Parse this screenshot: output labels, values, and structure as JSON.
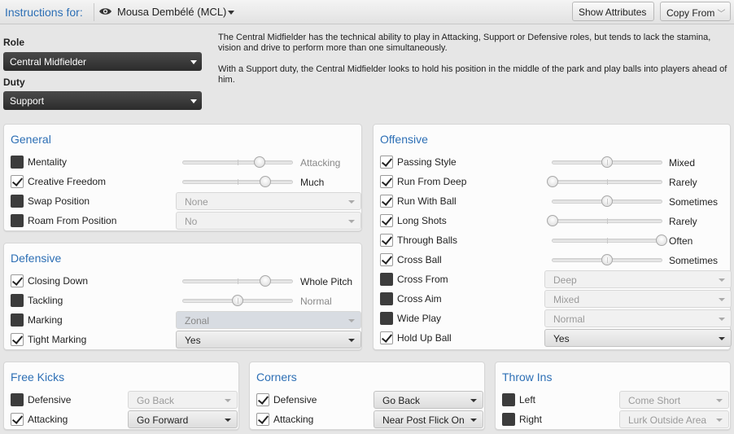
{
  "topbar": {
    "instructions_label": "Instructions for:",
    "player": "Mousa Dembélé (MCL)",
    "show_attributes": "Show Attributes",
    "copy_from": "Copy From"
  },
  "role": {
    "role_label": "Role",
    "role_value": "Central Midfielder",
    "duty_label": "Duty",
    "duty_value": "Support"
  },
  "description": {
    "p1": "The Central Midfielder has the technical ability to play in Attacking, Support or Defensive roles, but tends to lack the stamina, vision and drive to perform more than one simultaneously.",
    "p2": "With a Support duty, the Central Midfielder looks to hold his position in the middle of the park and play balls into players ahead of him."
  },
  "general": {
    "title": "General",
    "rows": [
      {
        "label": "Mentality",
        "checked": false,
        "slider": 0.7,
        "value": "Attacking",
        "enabled": false
      },
      {
        "label": "Creative Freedom",
        "checked": true,
        "slider": 0.75,
        "value": "Much",
        "enabled": true
      },
      {
        "label": "Swap Position",
        "checked": false,
        "select": "None",
        "enabled": false
      },
      {
        "label": "Roam From Position",
        "checked": false,
        "select": "No",
        "enabled": false
      }
    ]
  },
  "defensive": {
    "title": "Defensive",
    "rows": [
      {
        "label": "Closing Down",
        "checked": true,
        "slider": 0.75,
        "value": "Whole Pitch",
        "enabled": true
      },
      {
        "label": "Tackling",
        "checked": false,
        "slider": 0.5,
        "value": "Normal",
        "enabled": false
      },
      {
        "label": "Marking",
        "checked": false,
        "select": "Zonal",
        "enabled": false
      },
      {
        "label": "Tight Marking",
        "checked": true,
        "select": "Yes",
        "enabled": true
      }
    ]
  },
  "offensive": {
    "title": "Offensive",
    "rows": [
      {
        "label": "Passing Style",
        "checked": true,
        "slider": 0.5,
        "value": "Mixed",
        "enabled": true
      },
      {
        "label": "Run From Deep",
        "checked": true,
        "slider": 0.0,
        "value": "Rarely",
        "enabled": true
      },
      {
        "label": "Run With Ball",
        "checked": true,
        "slider": 0.5,
        "value": "Sometimes",
        "enabled": true
      },
      {
        "label": "Long Shots",
        "checked": true,
        "slider": 0.0,
        "value": "Rarely",
        "enabled": true
      },
      {
        "label": "Through Balls",
        "checked": true,
        "slider": 1.0,
        "value": "Often",
        "enabled": true
      },
      {
        "label": "Cross Ball",
        "checked": true,
        "slider": 0.5,
        "value": "Sometimes",
        "enabled": true
      },
      {
        "label": "Cross From",
        "checked": false,
        "select": "Deep",
        "enabled": false
      },
      {
        "label": "Cross Aim",
        "checked": false,
        "select": "Mixed",
        "enabled": false
      },
      {
        "label": "Wide Play",
        "checked": false,
        "select": "Normal",
        "enabled": false
      },
      {
        "label": "Hold Up Ball",
        "checked": true,
        "select": "Yes",
        "enabled": true
      }
    ]
  },
  "free_kicks": {
    "title": "Free Kicks",
    "rows": [
      {
        "label": "Defensive",
        "checked": false,
        "select": "Go Back",
        "enabled": false
      },
      {
        "label": "Attacking",
        "checked": true,
        "select": "Go Forward",
        "enabled": true
      }
    ]
  },
  "corners": {
    "title": "Corners",
    "rows": [
      {
        "label": "Defensive",
        "checked": true,
        "select": "Go Back",
        "enabled": true
      },
      {
        "label": "Attacking",
        "checked": true,
        "select": "Near Post Flick On",
        "enabled": true
      }
    ]
  },
  "throw_ins": {
    "title": "Throw Ins",
    "rows": [
      {
        "label": "Left",
        "checked": false,
        "select": "Come Short",
        "enabled": false
      },
      {
        "label": "Right",
        "checked": false,
        "select": "Lurk Outside Area",
        "enabled": false
      }
    ]
  },
  "colors": {
    "accent": "#2d6fb5",
    "dark_control": "#333333"
  }
}
